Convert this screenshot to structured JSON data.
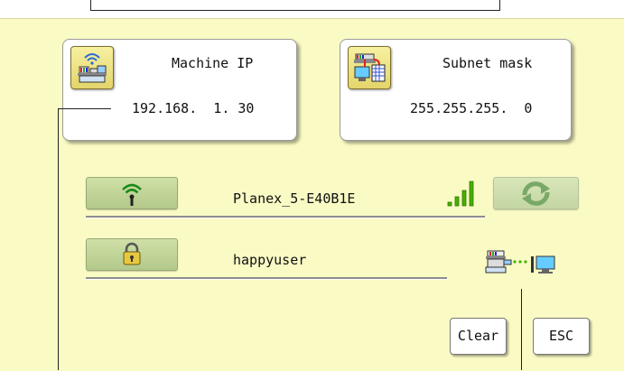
{
  "machine_ip": {
    "title": "Machine IP",
    "value": "192.168.  1. 30"
  },
  "subnet_mask": {
    "title": "Subnet mask",
    "value": "255.255.255.  0"
  },
  "wifi": {
    "ssid": "Planex_5-E40B1E"
  },
  "security": {
    "password_display": "happyuser"
  },
  "buttons": {
    "clear": "Clear",
    "esc": "ESC"
  },
  "icons": {
    "machine_ip": "machine-wireless-icon",
    "subnet": "network-computer-icon",
    "wifi": "wifi-icon",
    "lock": "lock-icon",
    "signal": "signal-strength-icon",
    "refresh": "refresh-icon",
    "connection": "machine-pc-connection-icon"
  },
  "colors": {
    "panel": "#fafac4",
    "green_button": "#c3d79a",
    "signal": "#46b000"
  }
}
